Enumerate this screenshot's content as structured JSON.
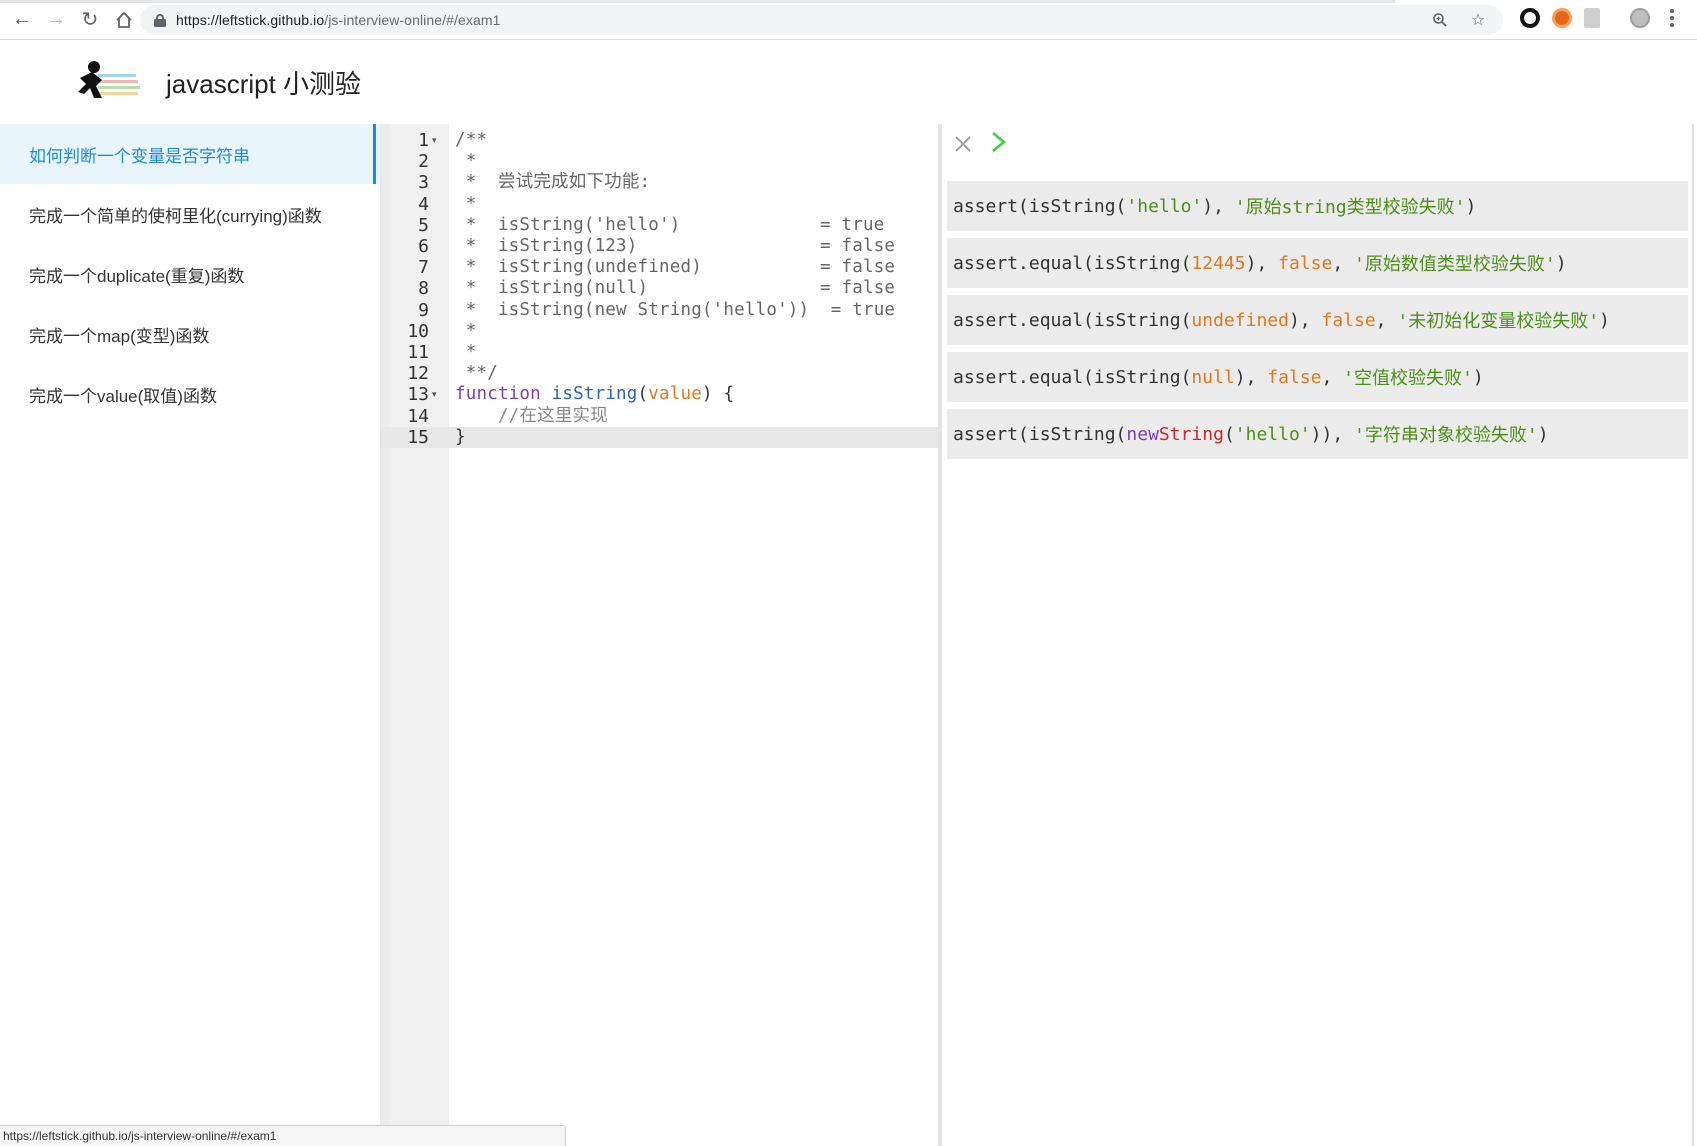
{
  "browser": {
    "url_host": "https://leftstick.github.io",
    "url_path": "/js-interview-online/#/exam1",
    "status_url": "https://leftstick.github.io/js-interview-online/#/exam1"
  },
  "header": {
    "title": "javascript 小测验"
  },
  "sidebar": {
    "items": [
      {
        "label": "如何判断一个变量是否字符串",
        "active": true
      },
      {
        "label": "完成一个简单的使柯里化(currying)函数",
        "active": false
      },
      {
        "label": "完成一个duplicate(重复)函数",
        "active": false
      },
      {
        "label": "完成一个map(变型)函数",
        "active": false
      },
      {
        "label": "完成一个value(取值)函数",
        "active": false
      }
    ]
  },
  "editor": {
    "current_line": 15,
    "lines": [
      {
        "n": "1",
        "text": "/**"
      },
      {
        "n": "2",
        "text": " *"
      },
      {
        "n": "3",
        "text": " *  尝试完成如下功能:"
      },
      {
        "n": "4",
        "text": " *"
      },
      {
        "n": "5",
        "text": " *  isString('hello')             = true"
      },
      {
        "n": "6",
        "text": " *  isString(123)                 = false"
      },
      {
        "n": "7",
        "text": " *  isString(undefined)           = false"
      },
      {
        "n": "8",
        "text": " *  isString(null)                = false"
      },
      {
        "n": "9",
        "text": " *  isString(new String('hello'))  = true"
      },
      {
        "n": "10",
        "text": " *"
      },
      {
        "n": "11",
        "text": " *"
      },
      {
        "n": "12",
        "text": " **/"
      },
      {
        "n": "13",
        "kw": "function",
        "fn": "isString",
        "param": "value"
      },
      {
        "n": "14",
        "text": "    //在这里实现"
      },
      {
        "n": "15",
        "text": "}"
      }
    ]
  },
  "tests": {
    "rows": [
      {
        "prefix": "assert(isString(",
        "arg": "'hello'",
        "mid": "), ",
        "expected": "",
        "msg": "'原始string类型校验失败'",
        "suffix": ")"
      },
      {
        "prefix": "assert.equal(isString(",
        "arg": "12445",
        "mid": "), ",
        "expected": "false",
        "msg": "'原始数值类型校验失败'",
        "suffix": ")"
      },
      {
        "prefix": "assert.equal(isString(",
        "arg": "undefined",
        "mid": "), ",
        "expected": "false",
        "msg": "'未初始化变量校验失败'",
        "suffix": ")"
      },
      {
        "prefix": "assert.equal(isString(",
        "arg": "null",
        "mid": "), ",
        "expected": "false",
        "msg": "'空值校验失败'",
        "suffix": ")"
      },
      {
        "prefix": "assert(isString(",
        "new_kw": "new",
        "cls": "String",
        "arg": "'hello'",
        "mid": ")), ",
        "expected": "",
        "msg": "'字符串对象校验失败'",
        "suffix": ")"
      }
    ]
  },
  "icons": {
    "back": "back-arrow-icon",
    "forward": "forward-arrow-icon",
    "reload": "reload-icon",
    "home": "home-icon",
    "lock": "lock-icon",
    "zoom": "zoom-icon",
    "star": "bookmark-star-icon",
    "close": "close-icon",
    "run": "run-chevron-icon"
  },
  "colors": {
    "accent": "#1e88e5",
    "active_bg": "#e8f5fd",
    "run_green": "#3bd23b"
  }
}
